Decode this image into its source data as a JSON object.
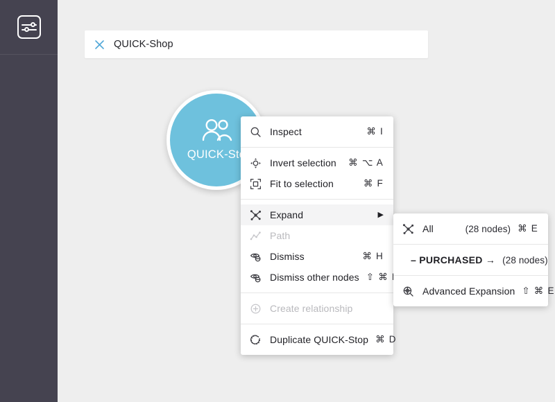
{
  "colors": {
    "sidebar_bg": "#454350",
    "canvas_bg": "#eeeeee",
    "node_fill": "#6ec1dd",
    "accent_blue": "#52a8d8",
    "menu_bg": "#ffffff",
    "disabled_text": "#b9b9bd"
  },
  "sidebar": {
    "icon_name": "sliders-icon"
  },
  "search": {
    "clear_icon": "close-x-icon",
    "value": "QUICK-Shop"
  },
  "node": {
    "icon": "users-icon",
    "label": "QUICK-Sto"
  },
  "context_menu": {
    "groups": [
      {
        "items": [
          {
            "icon": "magnifier-icon",
            "label": "Inspect",
            "accel": "⌘ I",
            "disabled": false,
            "highlight": false,
            "submenu": false
          }
        ]
      },
      {
        "items": [
          {
            "icon": "invert-selection-icon",
            "label": "Invert selection",
            "accel": "⌘ ⌥ A",
            "disabled": false,
            "highlight": false,
            "submenu": false
          },
          {
            "icon": "fit-to-selection-icon",
            "label": "Fit to selection",
            "accel": "⌘ F",
            "disabled": false,
            "highlight": false,
            "submenu": false
          }
        ]
      },
      {
        "items": [
          {
            "icon": "expand-graph-icon",
            "label": "Expand",
            "accel": "",
            "disabled": false,
            "highlight": true,
            "submenu": true
          },
          {
            "icon": "path-icon",
            "label": "Path",
            "accel": "",
            "disabled": true,
            "highlight": false,
            "submenu": false
          },
          {
            "icon": "hide-eye-icon",
            "label": "Dismiss",
            "accel": "⌘ H",
            "disabled": false,
            "highlight": false,
            "submenu": false
          },
          {
            "icon": "hide-eye-icon",
            "label": "Dismiss other nodes",
            "accel": "⇧ ⌘ H",
            "disabled": false,
            "highlight": false,
            "submenu": false
          }
        ]
      },
      {
        "items": [
          {
            "icon": "plus-circle-icon",
            "label": "Create relationship",
            "accel": "",
            "disabled": true,
            "highlight": false,
            "submenu": false
          }
        ]
      },
      {
        "items": [
          {
            "icon": "duplicate-icon",
            "label": "Duplicate QUICK-Stop",
            "accel": "⌘ D",
            "disabled": false,
            "highlight": false,
            "submenu": false
          }
        ]
      }
    ]
  },
  "expand_submenu": {
    "groups": [
      {
        "items": [
          {
            "icon": "expand-graph-icon",
            "label": "All",
            "count": "(28 nodes)",
            "accel": "⌘ E",
            "relationship": false
          }
        ]
      },
      {
        "items": [
          {
            "icon": "",
            "label": "– PURCHASED →",
            "count": "(28 nodes)",
            "accel": "",
            "relationship": true
          }
        ]
      },
      {
        "items": [
          {
            "icon": "advanced-expansion-icon",
            "label": "Advanced Expansion",
            "count": "",
            "accel": "⇧ ⌘ E",
            "relationship": false
          }
        ]
      }
    ]
  }
}
